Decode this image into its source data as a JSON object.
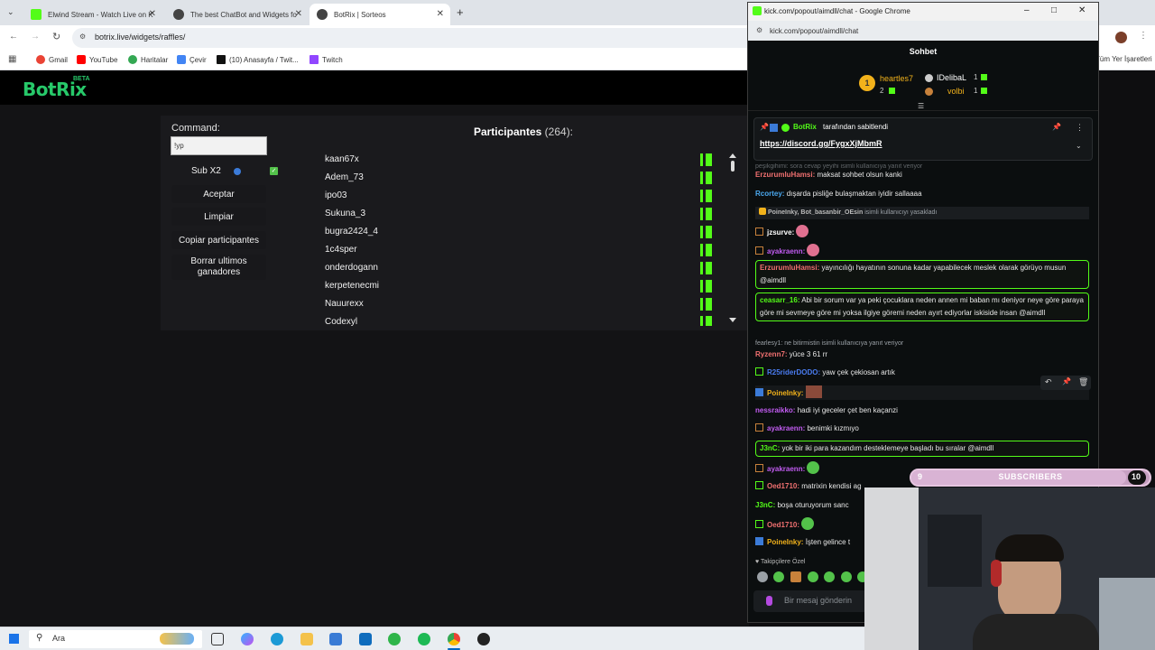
{
  "browser": {
    "tabs": [
      {
        "title": "Elwind Stream - Watch Live on K"
      },
      {
        "title": "The best ChatBot and Widgets fo"
      },
      {
        "title": "BotRix | Sorteos"
      }
    ],
    "new_tab": "+",
    "url": "botrix.live/widgets/raffles/",
    "bookmarks": [
      "Gmail",
      "YouTube",
      "Haritalar",
      "Çevir",
      "(10) Anasayfa / Twit...",
      "Twitch"
    ],
    "bookmarks_right": "Tüm Yer İşaretleri"
  },
  "botrix": {
    "logo": "BotRix",
    "beta": "BETA",
    "command_label": "Command:",
    "command_value": "!yp",
    "sub_label": "Sub X2",
    "buttons": {
      "accept": "Aceptar",
      "clear": "Limpiar",
      "copy": "Copiar participantes",
      "delete_winners": "Borrar ultimos ganadores"
    },
    "participants_title": "Participantes",
    "participants_count": "(264):",
    "participants": [
      "kaan67x",
      "Adem_73",
      "ipo03",
      "Sukuna_3",
      "bugra2424_4",
      "1c4sper",
      "onderdogann",
      "kerpetenecmi",
      "Nauurexx",
      "Codexyl"
    ]
  },
  "kick": {
    "window_title": "kick.com/popout/aimdll/chat - Google Chrome",
    "url": "kick.com/popout/aimdll/chat",
    "chat_title": "Sohbet",
    "leaderboard": {
      "first": {
        "rank": "1",
        "name": "heartles7",
        "count": "2"
      },
      "second": {
        "name": "IDelibaL",
        "count": "1"
      },
      "third": {
        "name": "volbi",
        "count": "1"
      }
    },
    "pinned": {
      "by_user": "BotRix",
      "by_text": "tarafından sabitlendi",
      "link": "https://discord.gg/FygxXjMbmR"
    },
    "messages": {
      "m0_sys": "peşikgihimi: sora cevap yeyihi isimli kullanıcıya yanıt veriyor",
      "m1_user": "ErzurumluHamsi:",
      "m1_text": "maksat sohbet olsun kanki",
      "m2_user": "Rcortey:",
      "m2_text": "dışarda pisliğe bulaşmaktan iyidir sallaaaa",
      "m3_sys_users": "PoineInky, Bot_basanbir_OEsin",
      "m3_sys_text": "isimli kullanıcıyı yasakladı",
      "m4_user": "jzsurve:",
      "m5_user": "ayakraenn:",
      "m6_user": "ErzurumluHamsi:",
      "m6_text": "yayıncılığı hayatının sonuna kadar yapabilecek meslek olarak görüyo musun @aimdll",
      "m7_user": "ceasarr_16:",
      "m7_text": "Abi bir sorum var ya peki çocuklara neden annen mi baban mı deniyor neye göre paraya göre mi sevmeye göre mi yoksa ilgiye göremi neden ayırt ediyorlar iskiside insan @aimdll",
      "m8_sys": "fearlesy1: ne bitirmistin isimli kullanıcıya yanıt veriyor",
      "m9_user": "Ryzenn7:",
      "m9_text": "yüce 3 61 rr",
      "m10_user": "R25riderDODO:",
      "m10_text": "yaw çek çekiosan artık",
      "m11_user": "PoineInky:",
      "m12_user": "nessraikko:",
      "m12_text": "hadi iyi geceler çet ben kaçanzi",
      "m13_user": "ayakraenn:",
      "m13_text": "benimki kızmıyo",
      "m14_user": "J3nC:",
      "m14_text": "yok bir iki para kazandım desteklemeye başladı bu sıralar @aimdll",
      "m15_user": "ayakraenn:",
      "m16_user": "Oed1710:",
      "m16_text": "matrixin kendisi ag",
      "m17_user": "J3nC:",
      "m17_text": "boşa oturuyorum sanc",
      "m18_user": "Oed1710:",
      "m19_user": "PoineInky:",
      "m19_text": "İşten gelince t"
    },
    "followers_label": "Takipçilere Özel",
    "input_placeholder": "Bir mesaj gönderin"
  },
  "overlay": {
    "subs_left": "9",
    "subs_label": "SUBSCRIBERS",
    "subs_right": "10",
    "subs_progress": 0.9
  },
  "taskbar": {
    "search": "Ara"
  },
  "colors": {
    "kick_green": "#53fc18",
    "botrix_green": "#27c96a",
    "highlight_border": "#53fc18"
  }
}
